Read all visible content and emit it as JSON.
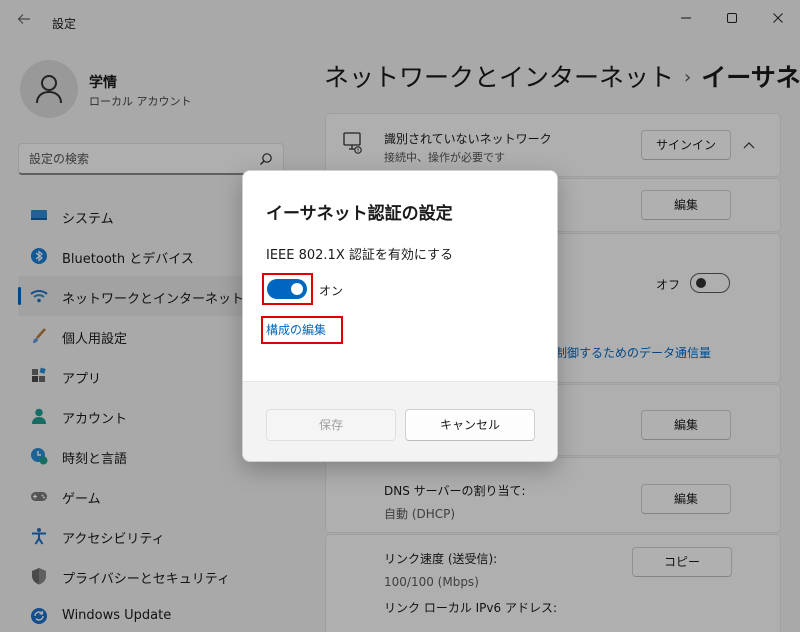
{
  "window": {
    "title": "設定"
  },
  "user": {
    "name": "学情",
    "account_type": "ローカル アカウント"
  },
  "search": {
    "placeholder": "設定の検索"
  },
  "sidebar": {
    "items": [
      {
        "label": "システム",
        "icon": "system-icon"
      },
      {
        "label": "Bluetooth とデバイス",
        "icon": "bluetooth-icon"
      },
      {
        "label": "ネットワークとインターネット",
        "icon": "network-icon"
      },
      {
        "label": "個人用設定",
        "icon": "personalization-icon"
      },
      {
        "label": "アプリ",
        "icon": "apps-icon"
      },
      {
        "label": "アカウント",
        "icon": "accounts-icon"
      },
      {
        "label": "時刻と言語",
        "icon": "time-language-icon"
      },
      {
        "label": "ゲーム",
        "icon": "gaming-icon"
      },
      {
        "label": "アクセシビリティ",
        "icon": "accessibility-icon"
      },
      {
        "label": "プライバシーとセキュリティ",
        "icon": "privacy-icon"
      },
      {
        "label": "Windows Update",
        "icon": "windows-update-icon"
      }
    ],
    "active_index": 2
  },
  "breadcrumb": {
    "parent": "ネットワークとインターネット",
    "separator": "›",
    "current": "イーサネット"
  },
  "main": {
    "network_title": "識別されていないネットワーク",
    "network_subtitle": "接続中、操作が必要です",
    "signin_button": "サインイン",
    "edit_button": "編集",
    "metered_toggle_state": "オフ",
    "data_usage_link": "を制御するためのデータ通信量",
    "dns_label": "DNS サーバーの割り当て:",
    "dns_value": "自動 (DHCP)",
    "link_speed_label": "リンク速度 (送受信):",
    "link_speed_value": "100/100 (Mbps)",
    "ipv6_label": "リンク ローカル IPv6 アドレス:",
    "copy_button": "コピー"
  },
  "dialog": {
    "title": "イーサネット認証の設定",
    "label": "IEEE 802.1X 認証を有効にする",
    "toggle_state": "オン",
    "toggle_on": true,
    "link": "構成の編集",
    "save_button": "保存",
    "cancel_button": "キャンセル"
  },
  "colors": {
    "accent": "#0067c0",
    "highlight": "#e00000"
  }
}
